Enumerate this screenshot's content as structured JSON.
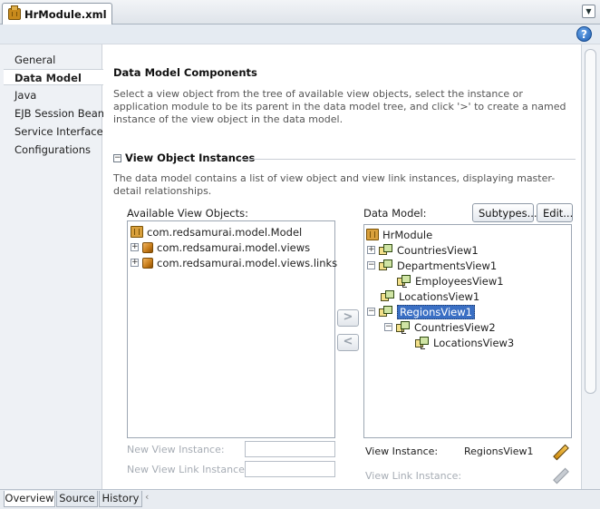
{
  "document_tab": {
    "title": "HrModule.xml",
    "icon": "application-module-icon"
  },
  "help": {
    "label": "?"
  },
  "nav": {
    "items": [
      {
        "label": "General",
        "selected": false
      },
      {
        "label": "Data Model",
        "selected": true
      },
      {
        "label": "Java",
        "selected": false
      },
      {
        "label": "EJB Session Bean",
        "selected": false
      },
      {
        "label": "Service Interface",
        "selected": false
      },
      {
        "label": "Configurations",
        "selected": false
      }
    ]
  },
  "main": {
    "title": "Data Model Components",
    "description": "Select a view object from the tree of available view objects, select the instance or application module to be its parent in the data model tree, and click '>' to create a named instance of the view object in the data model.",
    "section": {
      "title": "View Object Instances",
      "collapse_glyph": "−",
      "description": "The data model contains a list of view object and view link instances, displaying master-detail relationships."
    },
    "available": {
      "label": "Available View Objects:",
      "tree": [
        {
          "label": "com.redsamurai.model.Model"
        },
        {
          "label": "com.redsamurai.model.views",
          "expander": "+"
        },
        {
          "label": "com.redsamurai.model.views.links",
          "expander": "+"
        }
      ]
    },
    "shuttle": {
      "add": ">",
      "remove": "<"
    },
    "data_model": {
      "label": "Data Model:",
      "subtypes_button": "Subtypes...",
      "edit_button": "Edit...",
      "tree": [
        {
          "label": "HrModule"
        },
        {
          "label": "CountriesView1",
          "expander": "+"
        },
        {
          "label": "DepartmentsView1",
          "expander": "−"
        },
        {
          "label": "EmployeesView1"
        },
        {
          "label": "LocationsView1"
        },
        {
          "label": "RegionsView1",
          "expander": "−",
          "selected": true
        },
        {
          "label": "CountriesView2",
          "expander": "−"
        },
        {
          "label": "LocationsView3"
        }
      ]
    },
    "new_view_instance_label": "New View Instance:",
    "new_view_link_instance_label": "New View Link Instance:",
    "view_instance_label": "View Instance:",
    "view_instance_value": "RegionsView1",
    "view_link_instance_label": "View Link Instance:"
  },
  "bottom_tabs": [
    {
      "label": "Overview",
      "active": true
    },
    {
      "label": "Source",
      "active": false
    },
    {
      "label": "History",
      "active": false
    }
  ],
  "colors": {
    "selection": "#3a6fc4",
    "nav_background": "#eef1f5",
    "accent": "#1f5fb3"
  }
}
